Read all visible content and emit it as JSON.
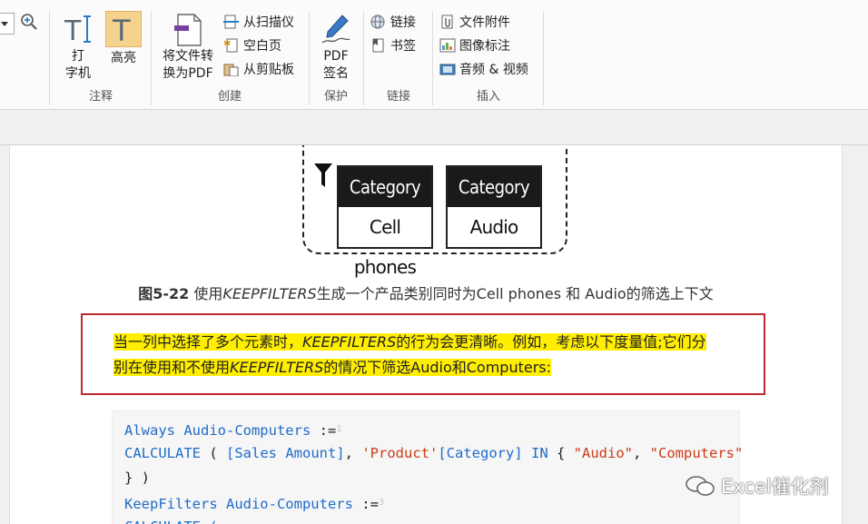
{
  "ribbon": {
    "annotate": {
      "label": "注释",
      "typewriter": {
        "line1": "打",
        "line2": "字机"
      },
      "highlight": {
        "label": "高亮"
      }
    },
    "create": {
      "label": "创建",
      "convert": {
        "line1": "将文件转",
        "line2": "换为PDF"
      },
      "from_scanner": "从扫描仪",
      "blank_page": "空白页",
      "from_clipboard": "从剪贴板"
    },
    "protect": {
      "label": "保护",
      "sign": {
        "line1": "PDF",
        "line2": "签名"
      }
    },
    "links": {
      "label": "链接",
      "link": "链接",
      "bookmark": "书签"
    },
    "insert": {
      "label": "插入",
      "file_attachment": "文件附件",
      "image_annotation": "图像标注",
      "audio_video": "音频 & 视频"
    }
  },
  "document": {
    "figure": {
      "box1": {
        "header": "Category",
        "value": "Cell phones"
      },
      "box2": {
        "header": "Category",
        "value": "Audio"
      }
    },
    "caption": {
      "num": "图5-22",
      "p1": " 使用",
      "func": "KEEPFILTERS",
      "p2": "生成一个产品类别同时为Cell phones 和 Audio的筛选上下文"
    },
    "highlight_paragraph": {
      "p1": "当一列中选择了多个元素时，",
      "func1": "KEEPFILTERS",
      "p2": "的行为会更清晰。例如，考虑以下度量值;它们分",
      "p3": "别在使用和不使用",
      "func2": "KEEPFILTERS",
      "p4": "的情况下筛选Audio和Computers:"
    },
    "code": {
      "l1_name": "Always Audio-Computers",
      "l1_op": " :=",
      "l1_num": "1",
      "l2_calc": "CALCULATE",
      "l2_a": " ( ",
      "l2_col": "[Sales Amount]",
      "l2_b": ", ",
      "l2_table": "'Product'",
      "l2_col2": "[Category]",
      "l2_c": " ",
      "l2_in": "IN",
      "l2_d": " { ",
      "l2_s1": "\"Audio\"",
      "l2_e": ", ",
      "l2_s2": "\"Computers\"",
      "l3": "} )",
      "l4_name": "KeepFilters Audio-Computers",
      "l4_op": " :=",
      "l4_num": "3",
      "l5": "CALCULATE ("
    },
    "watermark": "Excel催化剂"
  },
  "colors": {
    "highlight": "#ffee00",
    "box_border": "#c0282d",
    "keyword": "#1f6cc9",
    "string": "#cc3b18"
  }
}
